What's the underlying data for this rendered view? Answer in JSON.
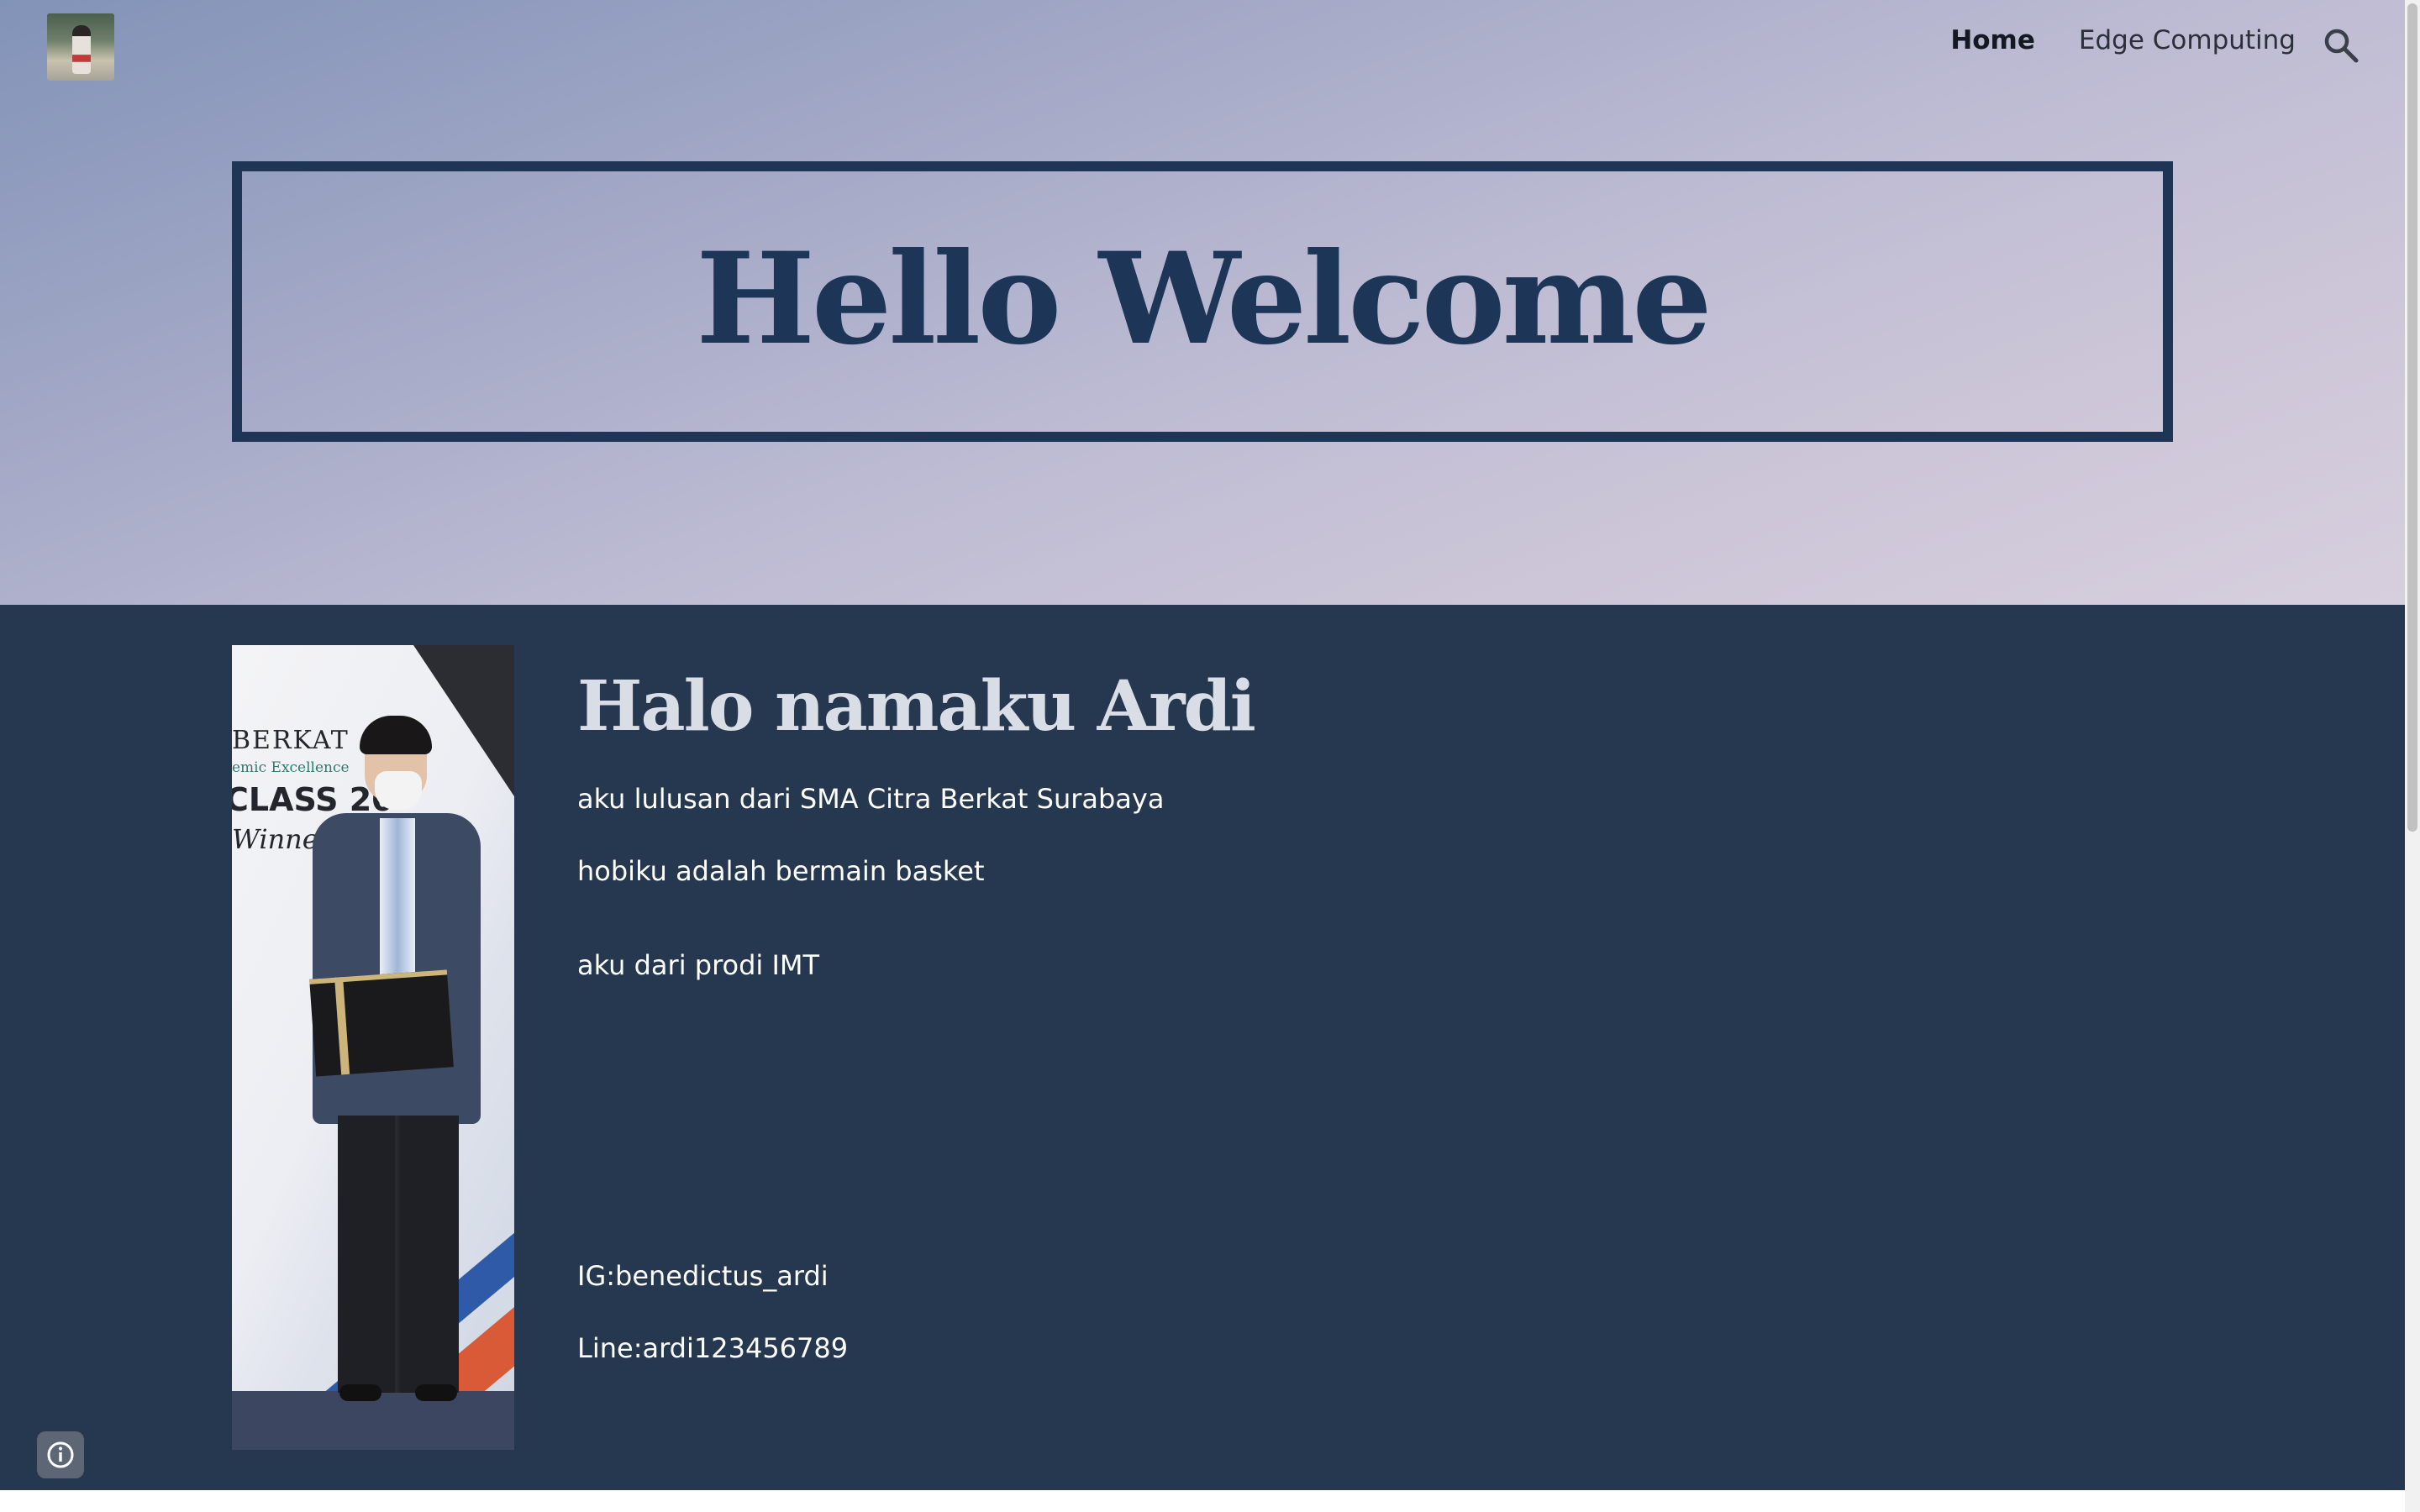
{
  "header": {
    "nav": [
      {
        "label": "Home",
        "active": true
      },
      {
        "label": "Edge Computing",
        "active": false
      }
    ],
    "search_icon": "search-icon",
    "logo_alt": "site-logo-photo"
  },
  "hero": {
    "title": "Hello Welcome"
  },
  "profile": {
    "heading": "Halo namaku Ardi",
    "lines": [
      "aku lulusan dari SMA Citra Berkat Surabaya",
      "hobiku adalah bermain basket",
      "aku dari prodi IMT",
      "IG:benedictus_ardi",
      "Line:ardi123456789"
    ],
    "photo_banner_text": [
      "BERKAT",
      "emic Excellence",
      "CLASS 20",
      "Winner"
    ]
  },
  "footer": {
    "info_icon": "info-icon"
  },
  "colors": {
    "title_navy": "#1d3557",
    "section_bg": "#25384f",
    "heading_light": "#d9dde6"
  }
}
